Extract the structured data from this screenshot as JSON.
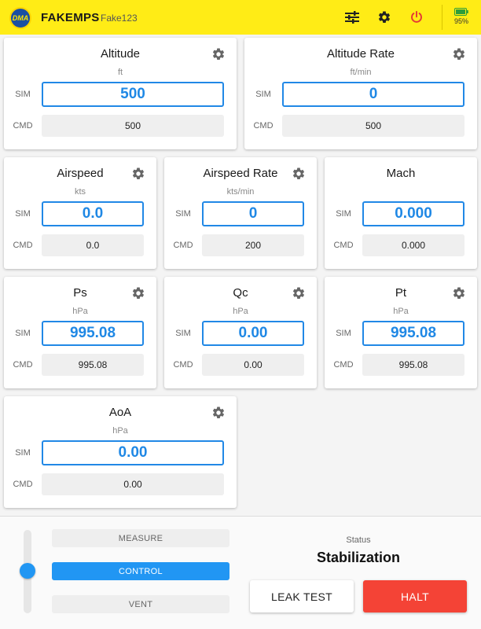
{
  "header": {
    "logo_text": "DMA",
    "app_title": "FAKEMPS",
    "device_name": "Fake123",
    "icons": [
      "sliders-icon",
      "gear-icon",
      "power-icon"
    ],
    "battery_percent": "95%",
    "colors": {
      "bar": "#ffec16",
      "power": "#e53935",
      "battery": "#2e9e3a"
    }
  },
  "labels": {
    "sim": "SIM",
    "cmd": "CMD"
  },
  "cards": [
    {
      "title": "Altitude",
      "unit": "ft",
      "sim": "500",
      "cmd": "500"
    },
    {
      "title": "Altitude Rate",
      "unit": "ft/min",
      "sim": "0",
      "cmd": "500"
    },
    {
      "title": "Airspeed",
      "unit": "kts",
      "sim": "0.0",
      "cmd": "0.0"
    },
    {
      "title": "Airspeed Rate",
      "unit": "kts/min",
      "sim": "0",
      "cmd": "200"
    },
    {
      "title": "Mach",
      "unit": "",
      "sim": "0.000",
      "cmd": "0.000"
    },
    {
      "title": "Ps",
      "unit": "hPa",
      "sim": "995.08",
      "cmd": "995.08"
    },
    {
      "title": "Qc",
      "unit": "hPa",
      "sim": "0.00",
      "cmd": "0.00"
    },
    {
      "title": "Pt",
      "unit": "hPa",
      "sim": "995.08",
      "cmd": "995.08"
    },
    {
      "title": "AoA",
      "unit": "hPa",
      "sim": "0.00",
      "cmd": "0.00"
    }
  ],
  "modes": {
    "options": [
      "MEASURE",
      "CONTROL",
      "VENT"
    ],
    "selected": "CONTROL"
  },
  "status": {
    "label": "Status",
    "value": "Stabilization"
  },
  "actions": {
    "leak_test": "LEAK TEST",
    "halt": "HALT"
  },
  "colors": {
    "accent": "#2196f3",
    "halt": "#f44336"
  }
}
